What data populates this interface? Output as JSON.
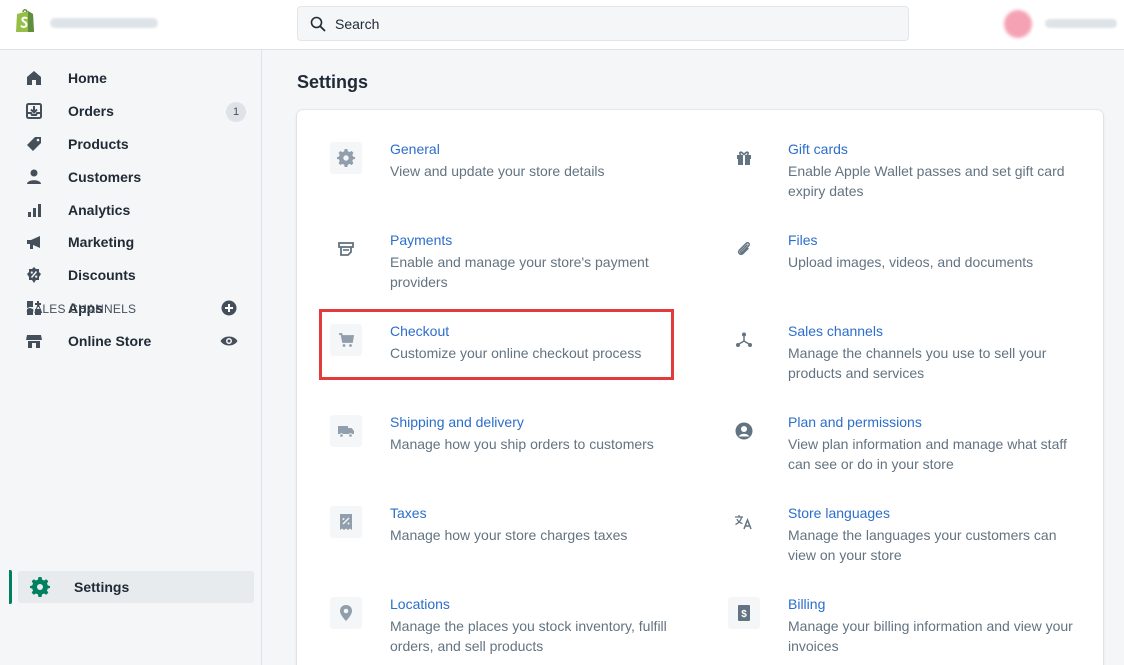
{
  "topbar": {
    "search_placeholder": "Search"
  },
  "sidebar": {
    "items": [
      {
        "label": "Home",
        "icon": "home-icon"
      },
      {
        "label": "Orders",
        "icon": "orders-icon",
        "badge": "1"
      },
      {
        "label": "Products",
        "icon": "tag-icon"
      },
      {
        "label": "Customers",
        "icon": "person-icon"
      },
      {
        "label": "Analytics",
        "icon": "bar-chart-icon"
      },
      {
        "label": "Marketing",
        "icon": "megaphone-icon"
      },
      {
        "label": "Discounts",
        "icon": "discount-icon"
      },
      {
        "label": "Apps",
        "icon": "apps-icon"
      }
    ],
    "sales_channels_heading": "SALES CHANNELS",
    "online_store_label": "Online Store",
    "settings_label": "Settings"
  },
  "main": {
    "title": "Settings",
    "settings": [
      {
        "title": "General",
        "desc": "View and update your store details",
        "icon": "gear-icon"
      },
      {
        "title": "Gift cards",
        "desc": "Enable Apple Wallet passes and set gift card expiry dates",
        "icon": "gift-icon"
      },
      {
        "title": "Payments",
        "desc": "Enable and manage your store's payment providers",
        "icon": "payment-icon"
      },
      {
        "title": "Files",
        "desc": "Upload images, videos, and documents",
        "icon": "paperclip-icon"
      },
      {
        "title": "Checkout",
        "desc": "Customize your online checkout process",
        "icon": "cart-icon"
      },
      {
        "title": "Sales channels",
        "desc": "Manage the channels you use to sell your products and services",
        "icon": "channels-icon"
      },
      {
        "title": "Shipping and delivery",
        "desc": "Manage how you ship orders to customers",
        "icon": "truck-icon"
      },
      {
        "title": "Plan and permissions",
        "desc": "View plan information and manage what staff can see or do in your store",
        "icon": "user-circle-icon"
      },
      {
        "title": "Taxes",
        "desc": "Manage how your store charges taxes",
        "icon": "tax-icon"
      },
      {
        "title": "Store languages",
        "desc": "Manage the languages your customers can view on your store",
        "icon": "translate-icon"
      },
      {
        "title": "Locations",
        "desc": "Manage the places you stock inventory, fulfill orders, and sell products",
        "icon": "location-pin-icon"
      },
      {
        "title": "Billing",
        "desc": "Manage your billing information and view your invoices",
        "icon": "billing-icon"
      }
    ]
  },
  "colors": {
    "link": "#2c6ecb",
    "highlight_border": "#e23b3b",
    "brand_green": "#008060"
  }
}
